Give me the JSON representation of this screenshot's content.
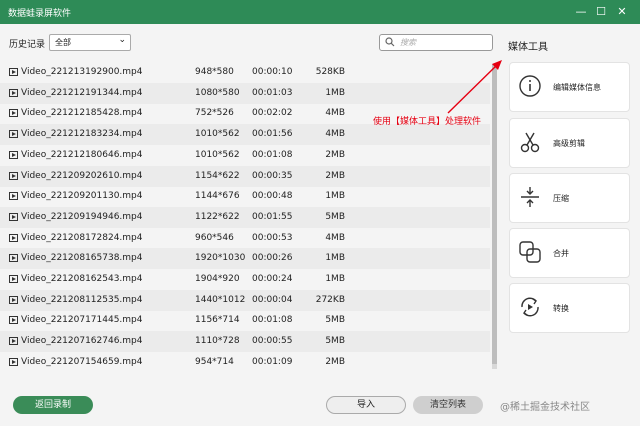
{
  "window": {
    "title": "数据蛙录屏软件"
  },
  "toolbar": {
    "history_label": "历史记录",
    "filter_value": "全部",
    "search_placeholder": "搜索"
  },
  "tools": {
    "header": "媒体工具",
    "items": [
      {
        "label": "编辑媒体信息",
        "icon": "info-icon"
      },
      {
        "label": "高级剪辑",
        "icon": "scissors-icon"
      },
      {
        "label": "压缩",
        "icon": "compress-icon"
      },
      {
        "label": "合并",
        "icon": "merge-icon"
      },
      {
        "label": "转换",
        "icon": "convert-icon"
      }
    ]
  },
  "annotation": {
    "text": "使用【媒体工具】处理软件",
    "color": "#e60012"
  },
  "files": [
    {
      "name": "Video_221213192900.mp4",
      "resolution": "948*580",
      "duration": "00:00:10",
      "size": "528KB"
    },
    {
      "name": "Video_221212191344.mp4",
      "resolution": "1080*580",
      "duration": "00:01:03",
      "size": "1MB"
    },
    {
      "name": "Video_221212185428.mp4",
      "resolution": "752*526",
      "duration": "00:02:02",
      "size": "4MB"
    },
    {
      "name": "Video_221212183234.mp4",
      "resolution": "1010*562",
      "duration": "00:01:56",
      "size": "4MB"
    },
    {
      "name": "Video_221212180646.mp4",
      "resolution": "1010*562",
      "duration": "00:01:08",
      "size": "2MB"
    },
    {
      "name": "Video_221209202610.mp4",
      "resolution": "1154*622",
      "duration": "00:00:35",
      "size": "2MB"
    },
    {
      "name": "Video_221209201130.mp4",
      "resolution": "1144*676",
      "duration": "00:00:48",
      "size": "1MB"
    },
    {
      "name": "Video_221209194946.mp4",
      "resolution": "1122*622",
      "duration": "00:01:55",
      "size": "5MB"
    },
    {
      "name": "Video_221208172824.mp4",
      "resolution": "960*546",
      "duration": "00:00:53",
      "size": "4MB"
    },
    {
      "name": "Video_221208165738.mp4",
      "resolution": "1920*1030",
      "duration": "00:00:26",
      "size": "1MB"
    },
    {
      "name": "Video_221208162543.mp4",
      "resolution": "1904*920",
      "duration": "00:00:24",
      "size": "1MB"
    },
    {
      "name": "Video_221208112535.mp4",
      "resolution": "1440*1012",
      "duration": "00:00:04",
      "size": "272KB"
    },
    {
      "name": "Video_221207171445.mp4",
      "resolution": "1156*714",
      "duration": "00:01:08",
      "size": "5MB"
    },
    {
      "name": "Video_221207162746.mp4",
      "resolution": "1110*728",
      "duration": "00:00:55",
      "size": "5MB"
    },
    {
      "name": "Video_221207154659.mp4",
      "resolution": "954*714",
      "duration": "00:01:09",
      "size": "2MB"
    }
  ],
  "footer": {
    "back_label": "返回录制",
    "import_label": "导入",
    "clear_label": "清空列表"
  },
  "watermark": "@稀土掘金技术社区",
  "colors": {
    "brand_green": "#2e8b57"
  }
}
